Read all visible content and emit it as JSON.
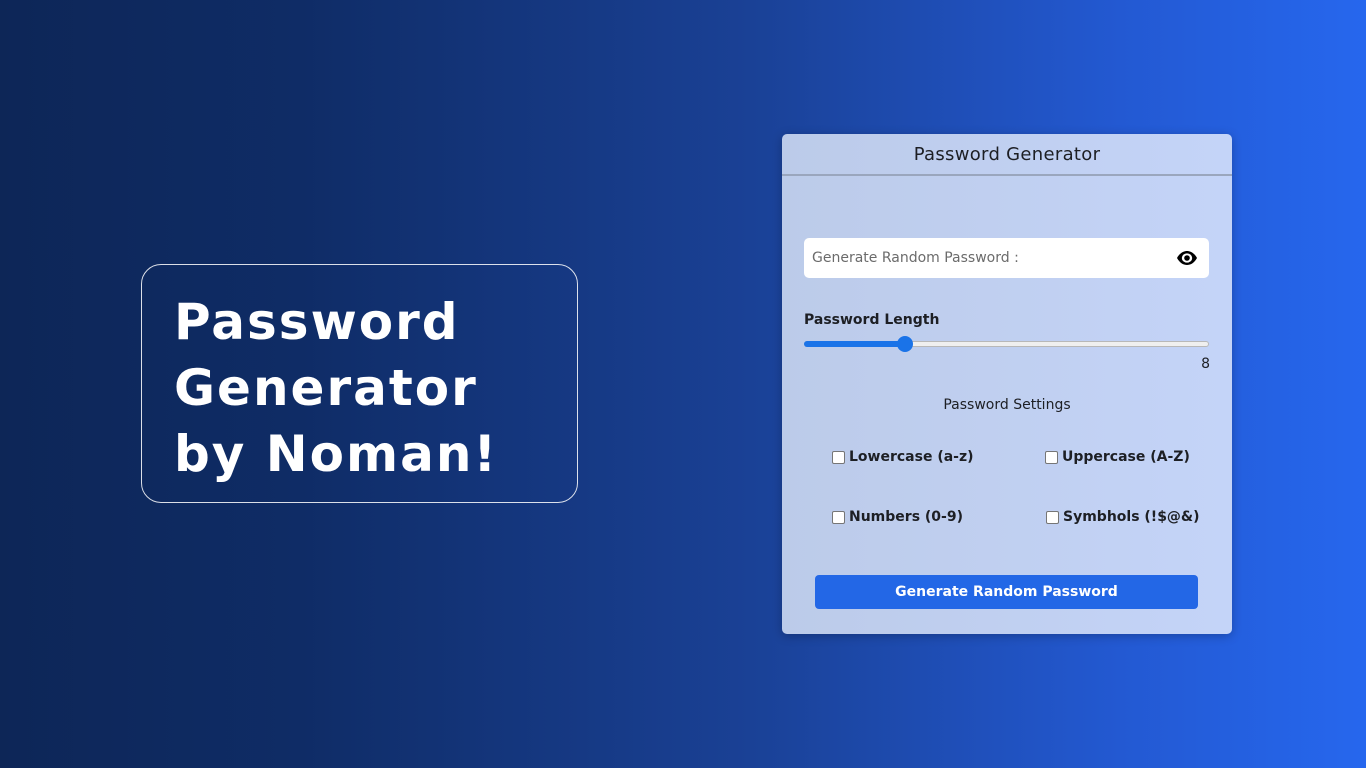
{
  "hero": {
    "title": "Password Generator by Noman!"
  },
  "card": {
    "title": "Password Generator",
    "password_field": {
      "placeholder": "Generate Random Password :",
      "value": "",
      "toggle_icon": "eye-icon"
    },
    "length": {
      "label": "Password Length",
      "value": "8",
      "min": 0,
      "max": 32,
      "fill_fraction": 0.25
    },
    "settings": {
      "title": "Password Settings",
      "options": [
        {
          "label": "Lowercase (a-z)",
          "checked": false
        },
        {
          "label": "Uppercase (A-Z)",
          "checked": false
        },
        {
          "label": "Numbers (0-9)",
          "checked": false
        },
        {
          "label": "Symbhols (!$@&)",
          "checked": false
        }
      ]
    },
    "generate_button": "Generate Random Password"
  },
  "colors": {
    "accent": "#2367e6",
    "slider": "#1a73e8",
    "card_bg": "#c4d4f8",
    "bg_dark": "#0d2657",
    "bg_light": "#2667ee"
  }
}
